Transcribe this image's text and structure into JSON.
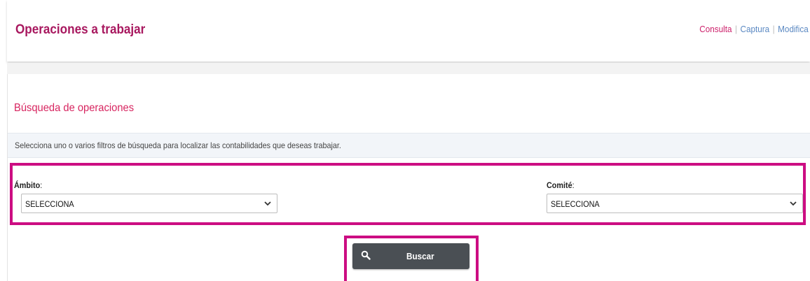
{
  "header": {
    "title": "Operaciones a trabajar",
    "links": [
      {
        "label": "Consulta",
        "state": "active"
      },
      {
        "label": "Captura",
        "state": "inactive"
      },
      {
        "label": "Modifica",
        "state": "inactive"
      }
    ],
    "separator": "|"
  },
  "search": {
    "title": "Búsqueda de operaciones",
    "instruction": "Selecciona uno o varios filtros de búsqueda para localizar las contabilidades que deseas trabajar.",
    "filters": {
      "ambito": {
        "label": "Ámbito",
        "suffix": ":",
        "selected": "SELECCIONA"
      },
      "comite": {
        "label": "Comité",
        "suffix": ":",
        "selected": "SELECCIONA"
      }
    },
    "button_label": "Buscar"
  },
  "colors": {
    "title": "#a8185f",
    "accent_link": "#cc1f6a",
    "link": "#5a88c2",
    "highlight_border": "#cc0d82",
    "button_bg": "#4a4f54"
  },
  "icons": {
    "search": "search-icon",
    "dropdown": "chevron-down-icon"
  }
}
